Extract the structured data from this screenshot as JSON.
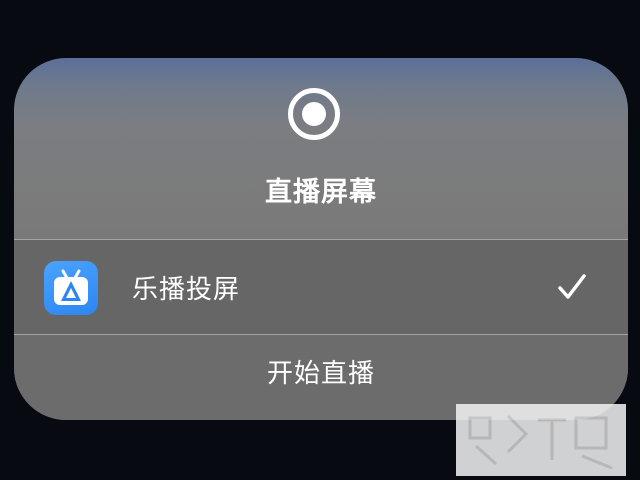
{
  "dialog": {
    "title": "直播屏幕",
    "header_icon": "record-icon"
  },
  "app_list": [
    {
      "name": "乐播投屏",
      "icon": "lebo-app-icon",
      "selected": true,
      "check_icon": "checkmark-icon"
    }
  ],
  "actions": {
    "start_label": "开始直播"
  },
  "colors": {
    "panel_top": "#5b6f98",
    "panel_body": "#7b7b7b",
    "row_bg": "#666666",
    "app_icon_blue": "#3a95fa",
    "text": "#ffffff"
  }
}
